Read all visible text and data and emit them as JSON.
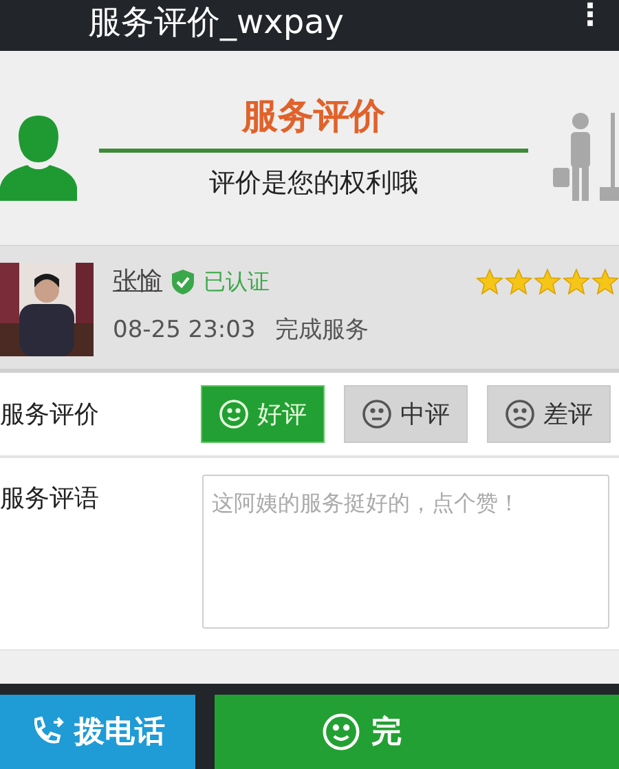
{
  "app_bar": {
    "title": "服务评价_wxpay",
    "menu": "⋮"
  },
  "banner": {
    "title": "服务评价",
    "subtitle": "评价是您的权利哦"
  },
  "worker": {
    "name": "张愉",
    "badge": "已认证",
    "time": "08-25 23:03",
    "status": "完成服务",
    "stars": 5
  },
  "rating": {
    "label": "服务评价",
    "options": [
      {
        "label": "好评",
        "kind": "smile",
        "selected": true
      },
      {
        "label": "中评",
        "kind": "neutral",
        "selected": false
      },
      {
        "label": "差评",
        "kind": "sad",
        "selected": false
      }
    ]
  },
  "comment": {
    "label": "服务评语",
    "placeholder": "这阿姨的服务挺好的，点个赞！"
  },
  "actions": [
    {
      "label": "拨电话",
      "kind": "call"
    },
    {
      "label": "完",
      "kind": "done"
    }
  ]
}
